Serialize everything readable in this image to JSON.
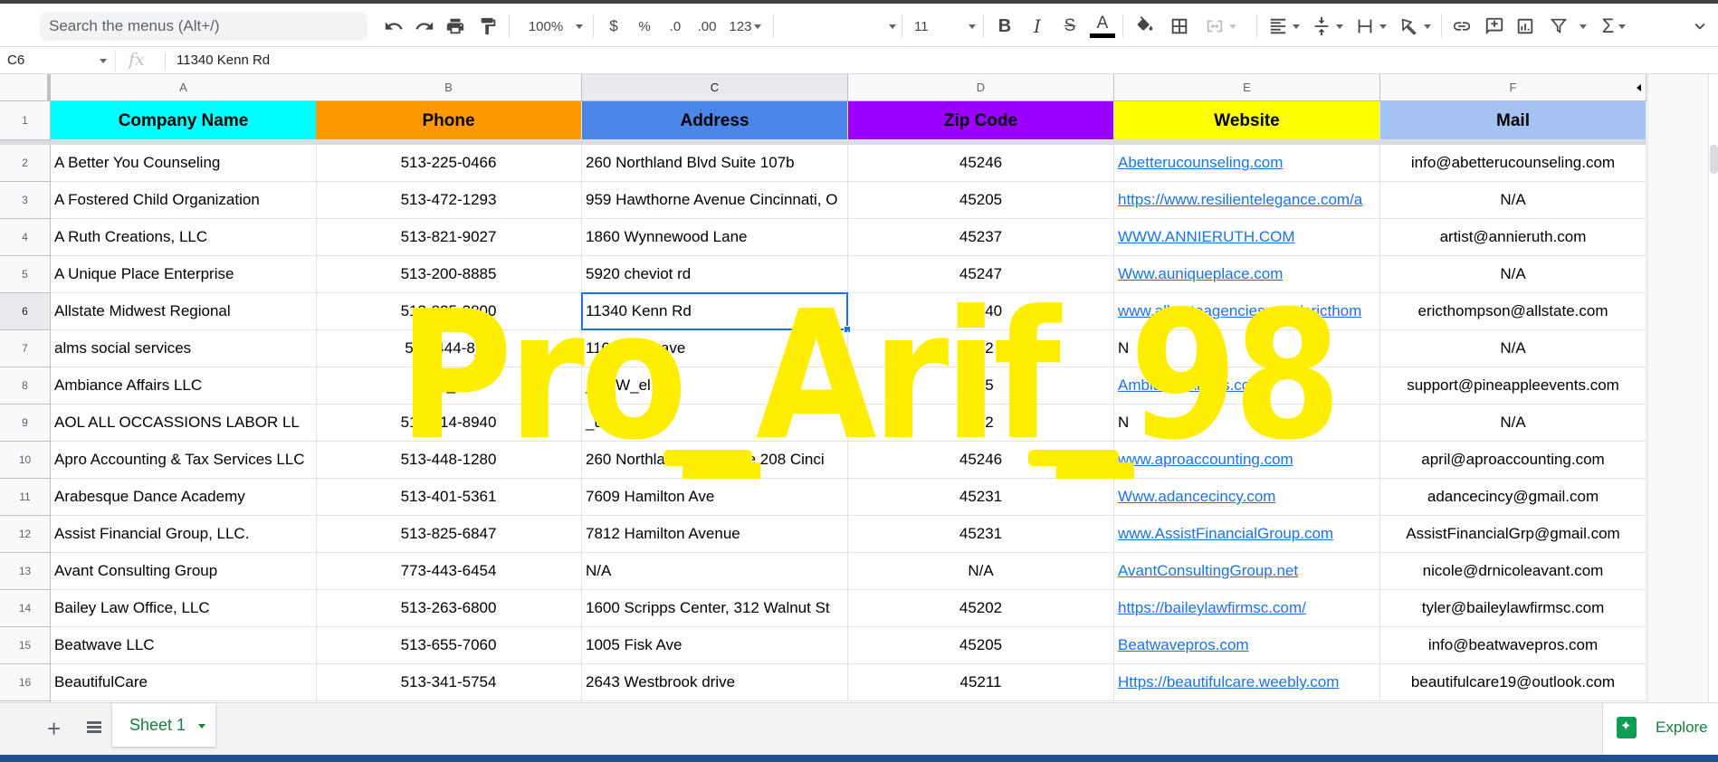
{
  "toolbar": {
    "search_placeholder": "Search the menus (Alt+/)",
    "zoom": "100%",
    "currency": "$",
    "percent": "%",
    "decrease_decimal": ".0",
    "increase_decimal": ".00",
    "more_formats": "123",
    "font_family": "",
    "font_size": "11",
    "bold": "B",
    "italic": "I",
    "strike": "S",
    "text_color": "A",
    "icons": [
      "undo-icon",
      "redo-icon",
      "print-icon",
      "paint-format-icon",
      "fill-color-icon",
      "borders-icon",
      "merge-cells-icon",
      "horizontal-align-icon",
      "vertical-align-icon",
      "text-wrap-icon",
      "text-rotation-icon",
      "insert-link-icon",
      "insert-comment-icon",
      "insert-chart-icon",
      "filter-icon",
      "functions-icon",
      "collapse-toolbar-icon"
    ]
  },
  "formula_bar": {
    "cell_ref": "C6",
    "fx": "fx",
    "value": "11340 Kenn Rd"
  },
  "sheet": {
    "columns": [
      "A",
      "B",
      "C",
      "D",
      "E",
      "F"
    ],
    "selected_column": "C",
    "selected_row": 6,
    "header_row": [
      {
        "label": "Company Name",
        "bg": "#00ffff"
      },
      {
        "label": "Phone",
        "bg": "#ff9900"
      },
      {
        "label": "Address",
        "bg": "#4a86e8"
      },
      {
        "label": "Zip Code",
        "bg": "#9900ff"
      },
      {
        "label": "Website",
        "bg": "#ffff00"
      },
      {
        "label": "Mail",
        "bg": "#a4c2f4"
      }
    ],
    "rows": [
      {
        "n": "2",
        "company": "A Better You Counseling",
        "phone": "513-225-0466",
        "address": "260 Northland Blvd Suite 107b",
        "zip": "45246",
        "website": "Abetterucounseling.com",
        "mail": "info@abetterucounseling.com"
      },
      {
        "n": "3",
        "company": "A Fostered Child Organization",
        "phone": "513-472-1293",
        "address": "959 Hawthorne Avenue Cincinnati, O",
        "zip": "45205",
        "website": "https://www.resilientelegance.com/a",
        "mail": "N/A"
      },
      {
        "n": "4",
        "company": "A Ruth Creations, LLC",
        "phone": "513-821-9027",
        "address": "1860 Wynnewood Lane",
        "zip": "45237",
        "website": "WWW.ANNIERUTH.COM",
        "mail": "artist@annieruth.com"
      },
      {
        "n": "5",
        "company": "A Unique Place Enterprise",
        "phone": "513-200-8885",
        "address": "5920 cheviot rd",
        "zip": "45247",
        "website": "Www.auniqueplace.com",
        "mail": "N/A"
      },
      {
        "n": "6",
        "company": "Allstate Midwest Regional",
        "phone": "513-825-3800",
        "address": "11340 Kenn Rd",
        "zip": "45240",
        "website": "www.allstateagencies.com/ericthom",
        "mail": "ericthompson@allstate.com"
      },
      {
        "n": "7",
        "company": "alms social services",
        "phone": "513-444-8_3",
        "address": "11071 oak ave",
        "zip": "452",
        "website": "N",
        "mail": "N/A",
        "website_plain": true
      },
      {
        "n": "8",
        "company": "Ambiance Affairs LLC",
        "phone": "51_-_066",
        "address": "_80 W_el Ln",
        "zip": "315",
        "website": "AmbianceAffairs.com",
        "mail": "support@pineappleevents.com"
      },
      {
        "n": "9",
        "company": "AOL ALL OCCASSIONS LABOR LL",
        "phone": "51_-_14-8940",
        "address": "_usanna Dr",
        "zip": "452",
        "website": "N",
        "mail": "N/A",
        "website_plain": true
      },
      {
        "n": "10",
        "company": "Apro Accounting & Tax Services LLC",
        "phone": "513-448-1280",
        "address": "260 Northland Blvd Suite 208 Cinci",
        "zip": "45246",
        "website": "www.aproaccounting.com",
        "mail": "april@aproaccounting.com"
      },
      {
        "n": "11",
        "company": "Arabesque Dance Academy",
        "phone": "513-401-5361",
        "address": "7609 Hamilton Ave",
        "zip": "45231",
        "website": "Www.adancecincy.com",
        "mail": "adancecincy@gmail.com"
      },
      {
        "n": "12",
        "company": "Assist Financial Group, LLC.",
        "phone": "513-825-6847",
        "address": "7812 Hamilton Avenue",
        "zip": "45231",
        "website": "www.AssistFinancialGroup.com",
        "mail": "AssistFinancialGrp@gmail.com"
      },
      {
        "n": "13",
        "company": "Avant Consulting Group",
        "phone": "773-443-6454",
        "address": "N/A",
        "zip": "N/A",
        "website": "AvantConsultingGroup.net",
        "mail": "nicole@drnicoleavant.com"
      },
      {
        "n": "14",
        "company": "Bailey Law Office, LLC",
        "phone": "513-263-6800",
        "address": "1600 Scripps Center, 312 Walnut St",
        "zip": "45202",
        "website": "https://baileylawfirmsc.com/",
        "mail": "tyler@baileylawfirmsc.com"
      },
      {
        "n": "15",
        "company": "Beatwave LLC",
        "phone": "513-655-7060",
        "address": "1005 Fisk Ave",
        "zip": "45205",
        "website": "Beatwavepros.com",
        "mail": "info@beatwavepros.com"
      },
      {
        "n": "16",
        "company": "BeautifulCare",
        "phone": "513-341-5754",
        "address": "2643 Westbrook drive",
        "zip": "45211",
        "website": "Https://beautifulcare.weebly.com",
        "mail": "beautifulcare19@outlook.com"
      }
    ]
  },
  "bottom": {
    "add_sheet": "+",
    "sheet_tab": "Sheet 1",
    "explore": "Explore"
  },
  "watermark": "Pro_Arif_98"
}
